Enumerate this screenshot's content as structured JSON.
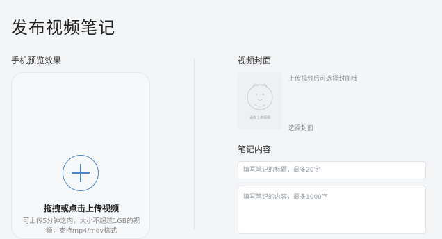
{
  "page": {
    "title": "发布视频笔记"
  },
  "preview": {
    "label": "手机预览效果",
    "upload_title": "拖拽或点击上传视频",
    "upload_hint": "可上传5分钟之内，大小不超过1GB的视频，支持mp4/mov格式"
  },
  "cover": {
    "label": "视频封面",
    "hint": "上传视频后可选择封面哦",
    "placeholder_caption": "请先上传视频",
    "select_label": "选择封面"
  },
  "note": {
    "label": "笔记内容",
    "title_placeholder": "填写笔记的标题，最多20字",
    "title_value": "",
    "content_placeholder": "填写笔记的内容，最多1000字",
    "content_value": ""
  },
  "colors": {
    "accent": "#4a86c8",
    "background": "#f4f5f7"
  },
  "icons": {
    "upload": "plus-icon",
    "cover_placeholder": "mascot-icon"
  }
}
